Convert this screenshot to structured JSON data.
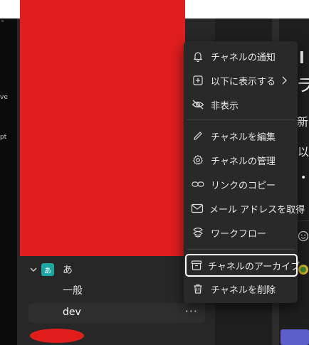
{
  "left_rail": {
    "label_1": "ve",
    "label_2": "pt"
  },
  "team": {
    "avatar_text": "あ",
    "name": "あ"
  },
  "channels": [
    {
      "name": "一般"
    },
    {
      "name": "dev"
    }
  ],
  "channel_more": "···",
  "context_menu": {
    "items": [
      {
        "label": "チャネルの通知",
        "icon": "bell-icon"
      },
      {
        "label": "以下に表示する",
        "icon": "add-square-icon",
        "submenu": true
      },
      {
        "label": "非表示",
        "icon": "eye-off-icon"
      },
      {
        "label": "チャネルを編集",
        "icon": "pencil-icon"
      },
      {
        "label": "チャネルの管理",
        "icon": "gear-icon"
      },
      {
        "label": "リンクのコピー",
        "icon": "link-icon"
      },
      {
        "label": "メール アドレスを取得",
        "icon": "mail-icon"
      },
      {
        "label": "ワークフロー",
        "icon": "workflow-icon"
      },
      {
        "label": "チャネルのアーカイブ",
        "icon": "archive-icon",
        "selected": true
      },
      {
        "label": "チャネルを削除",
        "icon": "trash-icon"
      }
    ]
  },
  "right_content": {
    "line1": "l",
    "line2": "ラ",
    "line3": "新",
    "line4": "以",
    "line5": "•"
  },
  "colors": {
    "redaction": "#e11e1e",
    "avatar": "#1aa7a1",
    "accent": "#5b5fc7"
  }
}
